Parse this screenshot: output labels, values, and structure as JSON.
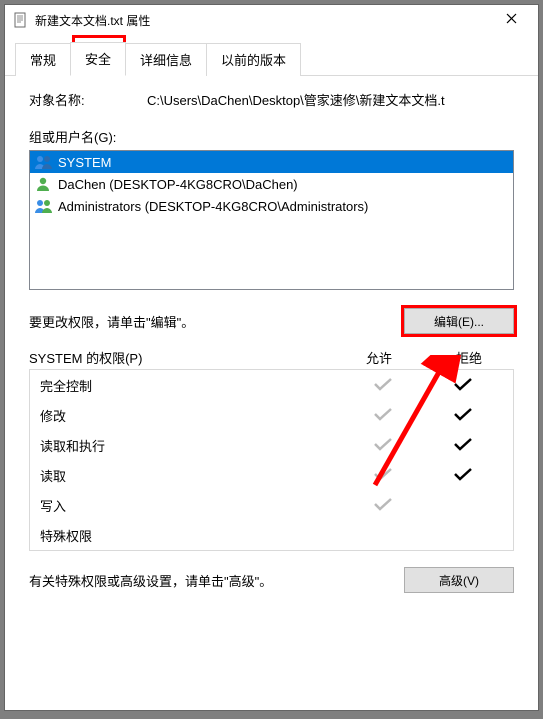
{
  "window": {
    "title": "新建文本文档.txt 属性"
  },
  "tabs": {
    "general": "常规",
    "security": "安全",
    "details": "详细信息",
    "previous": "以前的版本"
  },
  "object": {
    "label": "对象名称:",
    "value": "C:\\Users\\DaChen\\Desktop\\管家速修\\新建文本文档.t"
  },
  "groups": {
    "label": "组或用户名(G):",
    "items": [
      {
        "name": "SYSTEM",
        "icon": "group"
      },
      {
        "name": "DaChen (DESKTOP-4KG8CRO\\DaChen)",
        "icon": "user"
      },
      {
        "name": "Administrators (DESKTOP-4KG8CRO\\Administrators)",
        "icon": "group"
      }
    ]
  },
  "edit": {
    "hint": "要更改权限，请单击\"编辑\"。",
    "button": "编辑(E)..."
  },
  "perms": {
    "header_name": "SYSTEM 的权限(P)",
    "header_allow": "允许",
    "header_deny": "拒绝",
    "rows": [
      {
        "name": "完全控制",
        "allow": true,
        "deny": true
      },
      {
        "name": "修改",
        "allow": true,
        "deny": true
      },
      {
        "name": "读取和执行",
        "allow": true,
        "deny": true
      },
      {
        "name": "读取",
        "allow": true,
        "deny": true
      },
      {
        "name": "写入",
        "allow": true,
        "deny": false
      },
      {
        "name": "特殊权限",
        "allow": false,
        "deny": false
      }
    ]
  },
  "advanced": {
    "hint": "有关特殊权限或高级设置，请单击\"高级\"。",
    "button": "高级(V)"
  }
}
